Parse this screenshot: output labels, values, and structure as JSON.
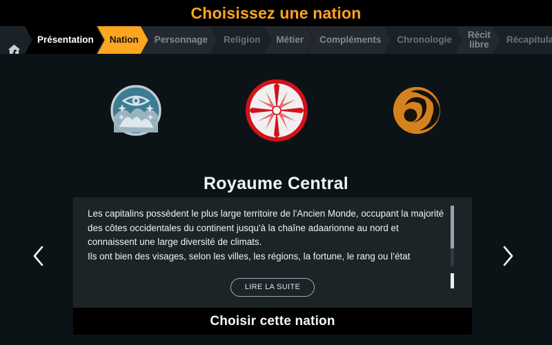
{
  "header": {
    "title": "Choisissez une nation",
    "title_color": "#ffa51f"
  },
  "breadcrumb": {
    "home_icon": "home-icon",
    "items": [
      {
        "label": "Présentation",
        "state": "done"
      },
      {
        "label": "Nation",
        "state": "active"
      },
      {
        "label": "Personnage",
        "state": "dim2"
      },
      {
        "label": "Religion",
        "state": "dim"
      },
      {
        "label": "Métier",
        "state": "dim2"
      },
      {
        "label": "Compléments",
        "state": "dim2"
      },
      {
        "label": "Chronologie",
        "state": "dim"
      },
      {
        "label": "Récit\nlibre",
        "state": "dim2"
      },
      {
        "label": "Récapitulatif",
        "state": "dim"
      }
    ]
  },
  "emblems": [
    {
      "name": "emblem-eye-mountain",
      "selected": false,
      "color": "#3d7d94"
    },
    {
      "name": "emblem-compass-rose",
      "selected": true,
      "color": "#d3111b"
    },
    {
      "name": "emblem-orange-swirl",
      "selected": false,
      "color": "#d4821d"
    }
  ],
  "nation": {
    "name": "Royaume Central",
    "description": "Les capitalins possèdent le plus large territoire de l'Ancien Monde, occupant la majorité des côtes occidentales du continent jusqu'à la chaîne adaarionne au nord et connaissent une large diversité de climats.\nIls ont bien des visages, selon les villes, les régions, la fortune, le rang ou l’état",
    "read_more_label": "LIRE LA SUITE",
    "choose_label": "Choisir cette nation"
  },
  "carousel": {
    "prev_icon": "chevron-left-icon",
    "next_icon": "chevron-right-icon"
  }
}
